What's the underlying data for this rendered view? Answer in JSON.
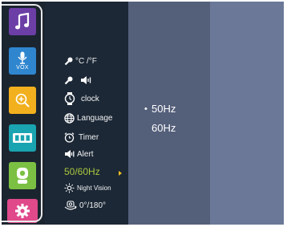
{
  "rail": {
    "items": [
      {
        "name": "music",
        "color": "#6b3fa6",
        "label": ""
      },
      {
        "name": "vox",
        "color": "#2f86cf",
        "label": "VOX"
      },
      {
        "name": "zoom",
        "color": "#f2b01e",
        "label": ""
      },
      {
        "name": "camera",
        "color": "#1aa3b0",
        "label": ""
      },
      {
        "name": "baby-unit",
        "color": "#7bc043",
        "label": ""
      },
      {
        "name": "settings",
        "color": "#e0498a",
        "label": ""
      }
    ]
  },
  "menu": {
    "items": [
      {
        "label": "°C /°F",
        "icon": "wrench-icon"
      },
      {
        "label": "",
        "icon": "wrench-speaker-icon"
      },
      {
        "label": "clock",
        "icon": "watch-icon"
      },
      {
        "label": "Language",
        "icon": "globe-icon"
      },
      {
        "label": "Timer",
        "icon": "alarm-clock-icon"
      },
      {
        "label": "Alert",
        "icon": "speaker-icon"
      },
      {
        "label": "50/60Hz",
        "icon": "",
        "selected": true
      },
      {
        "label": "Night Vision",
        "icon": "sun-icon"
      },
      {
        "label": "0°/180°",
        "icon": "rotate-icon"
      }
    ]
  },
  "options": {
    "items": [
      {
        "label": "50Hz",
        "selected": true
      },
      {
        "label": "60Hz",
        "selected": false
      }
    ],
    "selected_marker": "•"
  },
  "colors": {
    "selected_text": "#a9c83c",
    "arrow": "#f0c020"
  }
}
